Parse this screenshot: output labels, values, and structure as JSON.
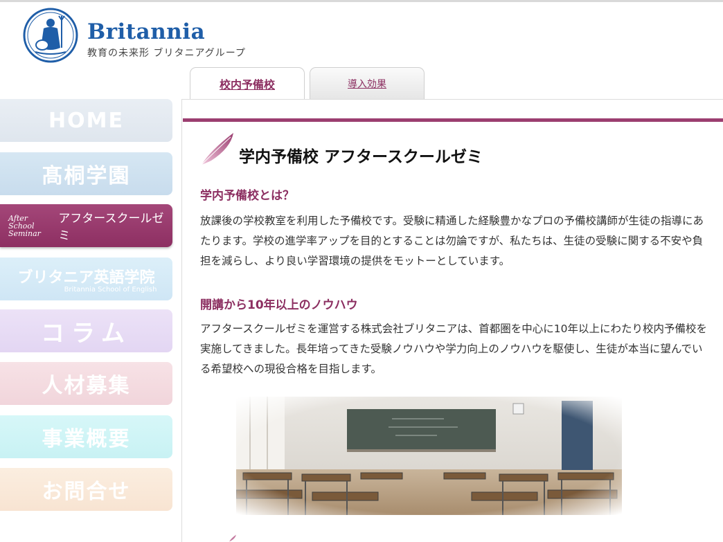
{
  "brand": {
    "name": "Britannia",
    "tagline": "教育の未来形 ブリタニアグループ",
    "color": "#1f5ea8"
  },
  "nav": {
    "home": "HOME",
    "gakuen": "髙桐学園",
    "after_script": "After School Seminar",
    "after_label": "アフタースクールゼミ",
    "english": "ブリタニア英語学院",
    "english_sub": "Britannia School of English",
    "column": "コラム",
    "recruit": "人材募集",
    "business": "事業概要",
    "contact": "お問合せ"
  },
  "tabs": {
    "active": "校内予備校",
    "inactive": "導入効果"
  },
  "content": {
    "title": "学内予備校 アフタースクールゼミ",
    "section1_heading": "学内予備校とは？",
    "section1_text": "放課後の学校教室を利用した予備校です。受験に精通した経験豊かなプロの予備校講師が生徒の指導にあたります。学校の進学率アップを目的とすることは勿論ですが、私たちは、生徒の受験に関する不安や負担を減らし、より良い学習環境の提供をモットーとしています。",
    "section2_heading": "開講から10年以上のノウハウ",
    "section2_text": "アフタースクールゼミを運営する株式会社ブリタニアは、首都圏を中心に10年以上にわたり校内予備校を実施してきました。長年培ってきた受験ノウハウや学力向上のノウハウを駆使し、生徒が本当に望んでいる希望校への現役合格を目指します。"
  },
  "colors": {
    "accent": "#8c2f61",
    "bar": "#9b3e70"
  },
  "icons": {
    "logo": "britannia-emblem-icon",
    "heading": "quill-feather-icon"
  }
}
